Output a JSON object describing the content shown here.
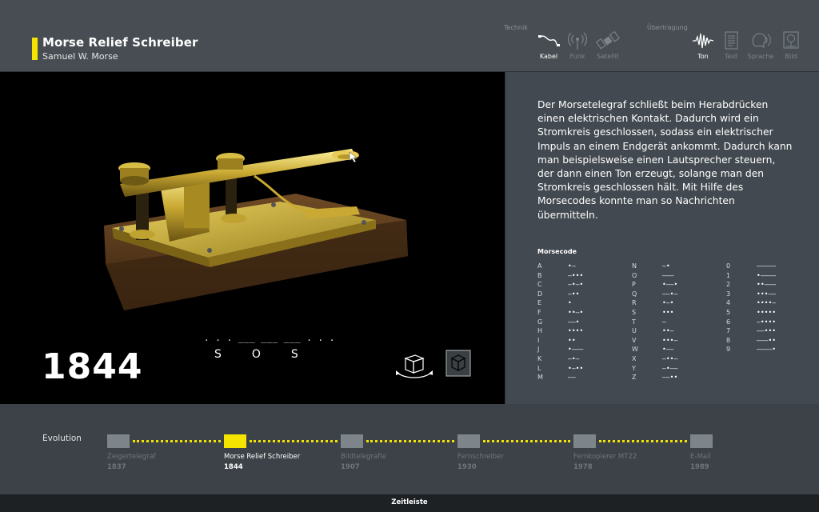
{
  "header": {
    "title": "Morse Relief Schreiber",
    "subtitle": "Samuel W. Morse",
    "categories": {
      "technik": "Technik",
      "uebertragung": "Übertragung"
    },
    "technik_items": [
      {
        "label": "Kabel",
        "icon": "cable-icon",
        "active": true
      },
      {
        "label": "Funk",
        "icon": "radio-icon",
        "active": false
      },
      {
        "label": "Satellit",
        "icon": "satellite-icon",
        "active": false
      }
    ],
    "uebertragung_items": [
      {
        "label": "Ton",
        "icon": "sound-wave-icon",
        "active": true
      },
      {
        "label": "Text",
        "icon": "text-document-icon",
        "active": false
      },
      {
        "label": "Sprache",
        "icon": "speech-icon",
        "active": false
      },
      {
        "label": "Bild",
        "icon": "image-icon",
        "active": false
      }
    ]
  },
  "stage": {
    "year": "1844",
    "sos_code": ". . . ___ ___ ___ . . .",
    "sos_letters": "SOS"
  },
  "info": {
    "description": "Der Morsetelegraf schließt beim Herabdrücken einen elektrischen Kontakt. Dadurch wird ein Stromkreis geschlossen, sodass ein elektrischer Impuls an einem Endgerät ankommt. Dadurch kann man beispielsweise einen Lautsprecher steuern, der dann einen Ton erzeugt, solange man den Stromkreis geschlossen hält. Mit Hilfe des Morsecodes konnte man so Nachrichten übermitteln.",
    "morse_title": "Morsecode",
    "morse_col1": [
      {
        "k": "A",
        "c": "•—"
      },
      {
        "k": "B",
        "c": "—•••"
      },
      {
        "k": "C",
        "c": "—•—•"
      },
      {
        "k": "D",
        "c": "—••"
      },
      {
        "k": "E",
        "c": "•"
      },
      {
        "k": "F",
        "c": "••—•"
      },
      {
        "k": "G",
        "c": "——•"
      },
      {
        "k": "H",
        "c": "••••"
      },
      {
        "k": "I",
        "c": "••"
      },
      {
        "k": "J",
        "c": "•———"
      },
      {
        "k": "K",
        "c": "—•—"
      },
      {
        "k": "L",
        "c": "•—••"
      },
      {
        "k": "M",
        "c": "——"
      }
    ],
    "morse_col2": [
      {
        "k": "N",
        "c": "—•"
      },
      {
        "k": "O",
        "c": "———"
      },
      {
        "k": "P",
        "c": "•——•"
      },
      {
        "k": "Q",
        "c": "——•—"
      },
      {
        "k": "R",
        "c": "•—•"
      },
      {
        "k": "S",
        "c": "•••"
      },
      {
        "k": "T",
        "c": "—"
      },
      {
        "k": "U",
        "c": "••—"
      },
      {
        "k": "V",
        "c": "•••—"
      },
      {
        "k": "W",
        "c": "•——"
      },
      {
        "k": "X",
        "c": "—••—"
      },
      {
        "k": "Y",
        "c": "—•——"
      },
      {
        "k": "Z",
        "c": "——••"
      }
    ],
    "morse_col3": [
      {
        "k": "0",
        "c": "—————"
      },
      {
        "k": "1",
        "c": "•————"
      },
      {
        "k": "2",
        "c": "••———"
      },
      {
        "k": "3",
        "c": "•••——"
      },
      {
        "k": "4",
        "c": "••••—"
      },
      {
        "k": "5",
        "c": "•••••"
      },
      {
        "k": "6",
        "c": "—••••"
      },
      {
        "k": "7",
        "c": "——•••"
      },
      {
        "k": "8",
        "c": "———••"
      },
      {
        "k": "9",
        "c": "————•"
      }
    ]
  },
  "timeline": {
    "label": "Evolution",
    "items": [
      {
        "name": "Zeigertelegraf",
        "year": "1837",
        "active": false
      },
      {
        "name": "Morse Relief Schreiber",
        "year": "1844",
        "active": true
      },
      {
        "name": "Bildtelegrafie",
        "year": "1907",
        "active": false
      },
      {
        "name": "Fernschreiber",
        "year": "1930",
        "active": false
      },
      {
        "name": "Fernkopierer MT22",
        "year": "1978",
        "active": false
      },
      {
        "name": "E-Mail",
        "year": "1989",
        "active": false
      }
    ]
  },
  "footer": {
    "label": "Zeitleiste"
  },
  "colors": {
    "accent": "#f4e400",
    "header_bg": "#474d52",
    "panel_bg": "#424950",
    "stage_bg": "#000000"
  }
}
